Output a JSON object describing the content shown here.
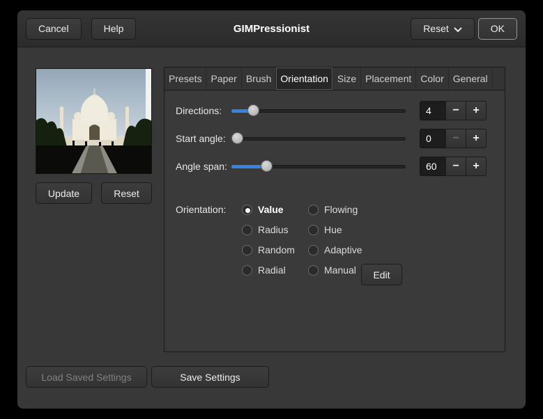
{
  "window": {
    "title": "GIMPressionist"
  },
  "header": {
    "cancel_label": "Cancel",
    "help_label": "Help",
    "reset_label": "Reset",
    "ok_label": "OK"
  },
  "preview": {
    "update_label": "Update",
    "reset_label": "Reset"
  },
  "tabs": [
    "Presets",
    "Paper",
    "Brush",
    "Orientation",
    "Size",
    "Placement",
    "Color",
    "General"
  ],
  "active_tab": "Orientation",
  "orientation": {
    "rows": [
      {
        "label": "Directions:",
        "value": "4",
        "fill": 0.1,
        "minus_disabled": false
      },
      {
        "label": "Start angle:",
        "value": "0",
        "fill": 0.0,
        "minus_disabled": true
      },
      {
        "label": "Angle span:",
        "value": "60",
        "fill": 0.18,
        "minus_disabled": false
      }
    ],
    "orientation_label": "Orientation:",
    "selected": "Value",
    "radio_columns": [
      [
        "Value",
        "Radius",
        "Random",
        "Radial"
      ],
      [
        "Flowing",
        "Hue",
        "Adaptive",
        "Manual"
      ]
    ],
    "edit_label": "Edit"
  },
  "footer": {
    "load_label": "Load Saved Settings",
    "save_label": "Save Settings",
    "load_disabled": true
  },
  "colors": {
    "accent_blue": "#3584e4"
  }
}
